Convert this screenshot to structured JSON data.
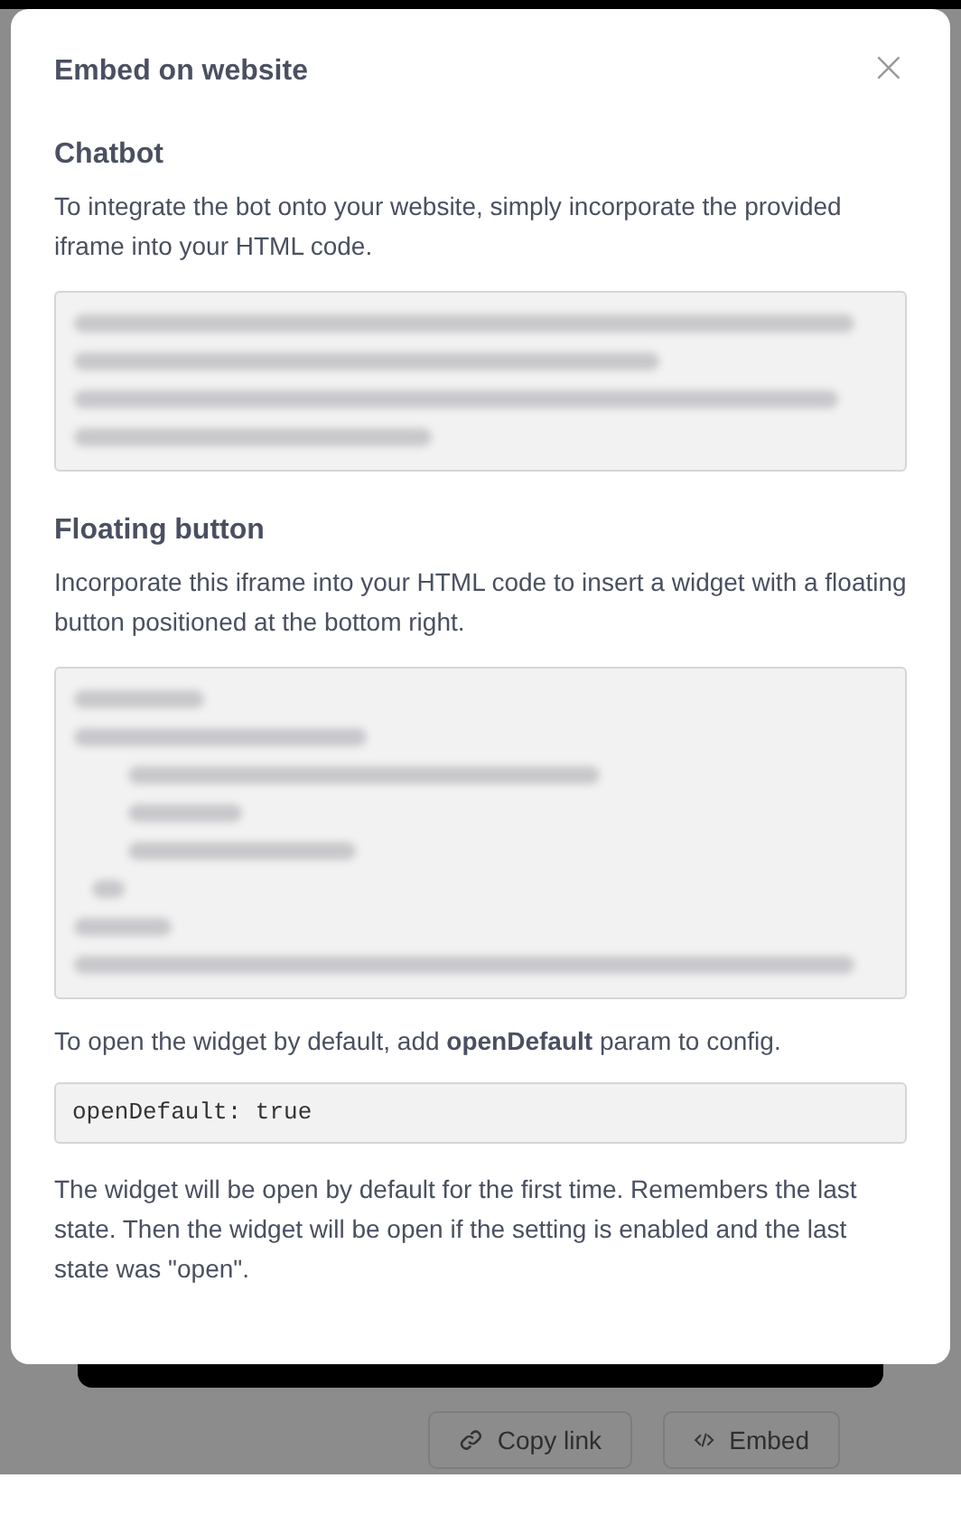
{
  "background": {
    "buttons": [
      {
        "kind": "link",
        "label": "Copy link"
      },
      {
        "kind": "code",
        "label": "Embed"
      }
    ]
  },
  "modal": {
    "title": "Embed on website",
    "close": "×",
    "sections": [
      {
        "heading": "Chatbot",
        "text": "To integrate the bot onto your website, simply incorporate the provided iframe into your HTML code."
      },
      {
        "heading": "Floating button",
        "text": "Incorporate this iframe into your HTML code to insert a widget with a floating button positioned at the bottom right."
      }
    ],
    "hint": "To open the widget by default, add **openDefault** param to config.",
    "snippet": "openDefault: true",
    "note": "The widget will be open by default for the first time. Remembers the last state. Then the widget will be open if the setting is enabled and the last state was \"open\"."
  }
}
